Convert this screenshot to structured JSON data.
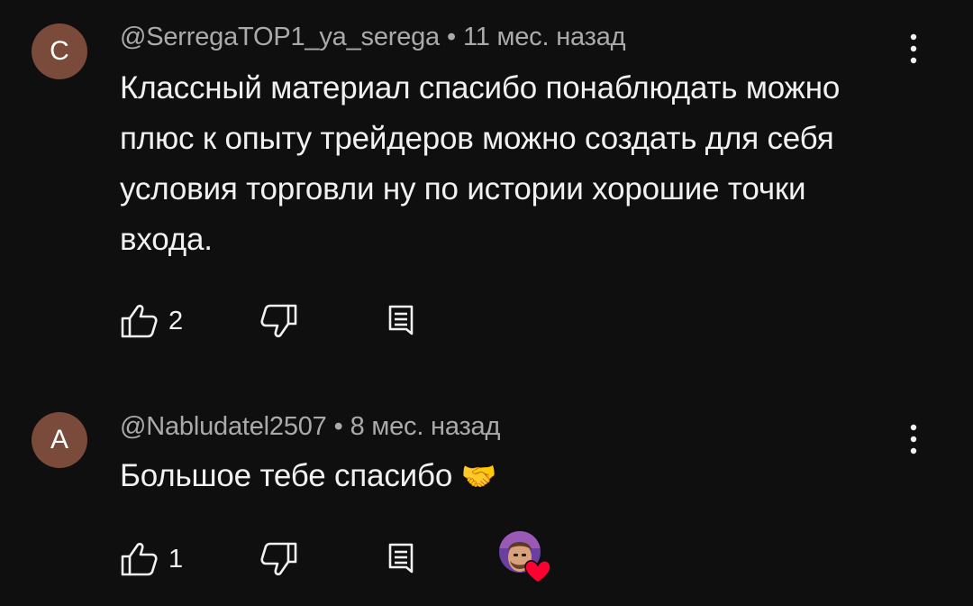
{
  "comments": [
    {
      "avatar_letter": "С",
      "avatar_color": "#7a4a3a",
      "author": "@SerregaTOP1_ya_serega",
      "separator": "•",
      "time": "11 мес. назад",
      "text": "Классный материал спасибо понаблюдать можно плюс к опыту трейдеров можно создать для себя условия торговли ну по истории хорошие точки входа.",
      "likes": "2",
      "icons": {
        "like": "thumb-up-icon",
        "dislike": "thumb-down-icon",
        "reply": "reply-icon",
        "menu": "more-vertical-icon"
      }
    },
    {
      "avatar_letter": "А",
      "avatar_color": "#7a4a3a",
      "author": "@Nabludatel2507",
      "separator": "•",
      "time": "8 мес. назад",
      "text": "Большое тебе спасибо",
      "emoji": "🤝",
      "likes": "1",
      "creator_heart": true,
      "icons": {
        "like": "thumb-up-icon",
        "dislike": "thumb-down-icon",
        "reply": "reply-icon",
        "menu": "more-vertical-icon",
        "heart": "heart-icon"
      }
    }
  ],
  "colors": {
    "background": "#0f0f0f",
    "text_primary": "#f1f1f1",
    "text_secondary": "#aaaaaa",
    "heart": "#ff0033"
  }
}
